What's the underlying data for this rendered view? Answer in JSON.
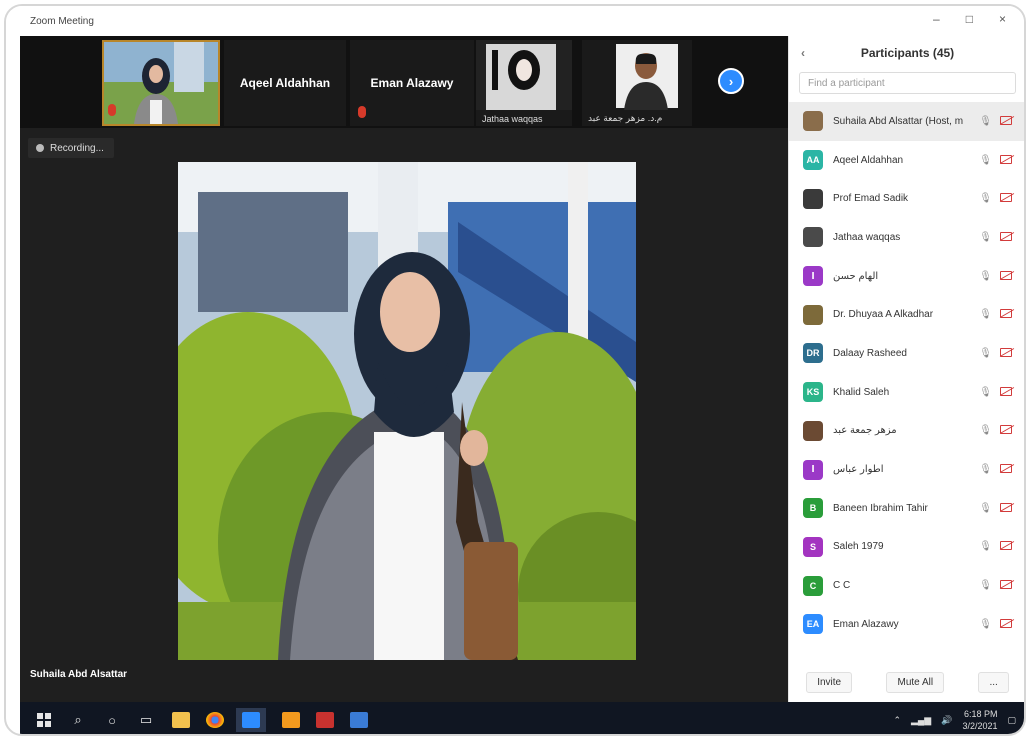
{
  "window": {
    "title": "Zoom Meeting",
    "controls": [
      "–",
      "□",
      "×"
    ]
  },
  "strip": {
    "tiles": [
      {
        "name": "",
        "caption": ""
      },
      {
        "name": "Aqeel Aldahhan",
        "caption": ""
      },
      {
        "name": "Eman Alazawy",
        "caption": ""
      },
      {
        "name": "",
        "caption": "Jathaa waqqas"
      },
      {
        "name": "",
        "caption": "م.د. مزهر جمعة عبد"
      }
    ],
    "next_label": "›"
  },
  "recording": {
    "label": "Recording..."
  },
  "speaker": {
    "name": "Suhaila Abd Alsattar"
  },
  "panel": {
    "back": "‹",
    "title": "Participants (45)",
    "search_placeholder": "Find a participant",
    "participants": [
      {
        "name": "Suhaila Abd Alsattar (Host, me)",
        "initial": "",
        "color": "#8a6d4b"
      },
      {
        "name": "Aqeel Aldahhan",
        "initial": "AA",
        "color": "#2bb5a5"
      },
      {
        "name": "Prof Emad Sadik",
        "initial": "",
        "color": "#3a3a3a"
      },
      {
        "name": "Jathaa waqqas",
        "initial": "",
        "color": "#4a4a4a"
      },
      {
        "name": "الهام حسن",
        "initial": "ا",
        "color": "#9b39c7"
      },
      {
        "name": "Dr. Dhuyaa A Alkadhar",
        "initial": "",
        "color": "#7d6a3a"
      },
      {
        "name": "Dalaay Rasheed",
        "initial": "DR",
        "color": "#2d6e8e"
      },
      {
        "name": "Khalid Saleh",
        "initial": "KS",
        "color": "#2bb58a"
      },
      {
        "name": "مزهر جمعة عبد",
        "initial": "",
        "color": "#6b4a33"
      },
      {
        "name": "اطوار عباس",
        "initial": "ا",
        "color": "#9b39c7"
      },
      {
        "name": "Baneen Ibrahim Tahir",
        "initial": "B",
        "color": "#2a9d3a"
      },
      {
        "name": "Saleh 1979",
        "initial": "S",
        "color": "#a334c0"
      },
      {
        "name": "C C",
        "initial": "C",
        "color": "#2a9d3a"
      },
      {
        "name": "Eman Alazawy",
        "initial": "EA",
        "color": "#2d8cff"
      }
    ],
    "invite_label": "Invite",
    "mute_all_label": "Mute All",
    "more_label": "..."
  },
  "taskbar": {
    "time": "6:18 PM",
    "date": "3/2/2021"
  }
}
